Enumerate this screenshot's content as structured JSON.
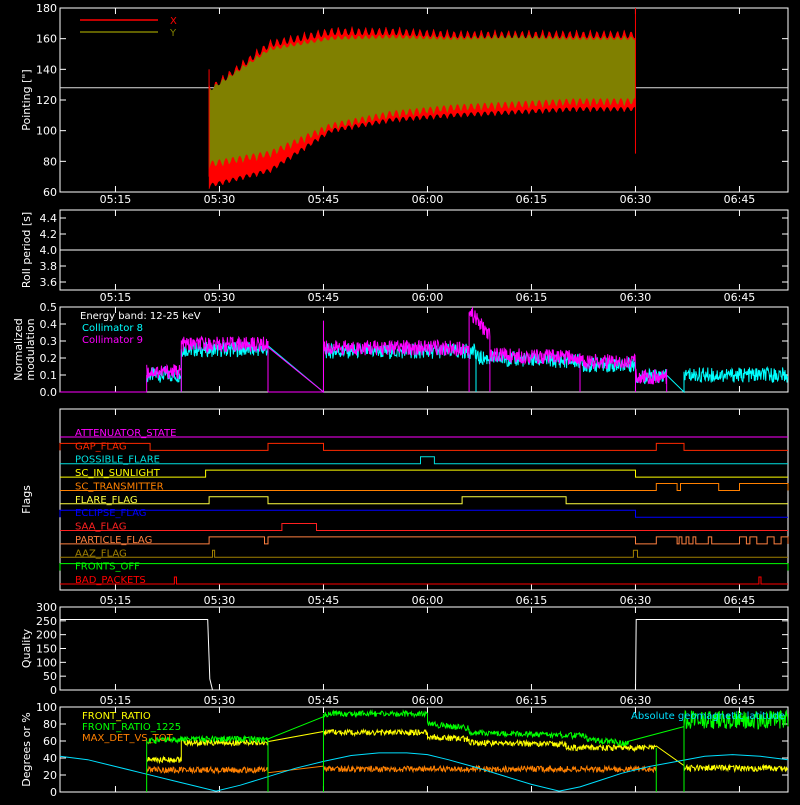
{
  "chart_data": {
    "type": "line",
    "time_ticks": [
      "05:15",
      "05:30",
      "05:45",
      "06:00",
      "06:15",
      "06:30",
      "06:45"
    ],
    "time_tick_minutes": [
      315,
      330,
      345,
      360,
      375,
      390,
      405
    ],
    "time_range_minutes": [
      307,
      412
    ],
    "panels": [
      {
        "id": "pointing",
        "ylabel": "Pointing [\"]",
        "yticks": [
          "60",
          "80",
          "100",
          "120",
          "140",
          "160",
          "180"
        ],
        "ylim": [
          60,
          180
        ],
        "reference_line": 128,
        "series": [
          {
            "name": "X",
            "color": "#ff0000",
            "active_minutes": [
              328.5,
              390
            ],
            "env_min": [
              62,
              72,
              98,
              105,
              108,
              110,
              112,
              112
            ],
            "env_max": [
              130,
              160,
              168,
              168,
              166,
              166,
              166,
              166
            ]
          },
          {
            "name": "Y",
            "color": "#808000",
            "active_minutes": [
              328.5,
              390
            ],
            "env_min": [
              75,
              82,
              100,
              108,
              112,
              114,
              116,
              116
            ],
            "env_max": [
              128,
              155,
              162,
              163,
              162,
              163,
              162,
              162
            ]
          }
        ]
      },
      {
        "id": "roll",
        "ylabel": "Roll period [s]",
        "yticks": [
          "3.6",
          "3.8",
          "4.0",
          "4.2",
          "4.4"
        ],
        "ylim": [
          3.5,
          4.5
        ],
        "value": 4.0
      },
      {
        "id": "modulation",
        "ylabel": [
          "Normalized",
          "modulation"
        ],
        "yticks": [
          "0.0",
          "0.1",
          "0.2",
          "0.3",
          "0.4",
          "0.5"
        ],
        "ylim": [
          0,
          0.5
        ],
        "annotation": "Energy band: 12-25 keV",
        "series": [
          {
            "name": "Collimator 8",
            "color": "#00ffff",
            "segments": [
              {
                "x": [
                  319.5,
                  324.5
                ],
                "y": [
                  0.1,
                  0.1
                ]
              },
              {
                "x": [
                  324.5,
                  337
                ],
                "y": [
                  0.25,
                  0.25
                ]
              },
              {
                "x": [
                  345,
                  367
                ],
                "y": [
                  0.24,
                  0.24
                ]
              },
              {
                "x": [
                  367,
                  382
                ],
                "y": [
                  0.2,
                  0.18
                ]
              },
              {
                "x": [
                  382,
                  390
                ],
                "y": [
                  0.16,
                  0.16
                ]
              },
              {
                "x": [
                  390,
                  394.5
                ],
                "y": [
                  0.09,
                  0.09
                ]
              },
              {
                "x": [
                  397,
                  412
                ],
                "y": [
                  0.1,
                  0.1
                ]
              }
            ]
          },
          {
            "name": "Collimator 9",
            "color": "#ff00ff",
            "segments": [
              {
                "x": [
                  319.5,
                  324.5
                ],
                "y": [
                  0.12,
                  0.12
                ]
              },
              {
                "x": [
                  324.5,
                  337
                ],
                "y": [
                  0.28,
                  0.28
                ]
              },
              {
                "x": [
                  345,
                  366
                ],
                "y": [
                  0.26,
                  0.26
                ]
              },
              {
                "x": [
                  366,
                  369
                ],
                "y": [
                  0.48,
                  0.33
                ]
              },
              {
                "x": [
                  369,
                  382
                ],
                "y": [
                  0.22,
                  0.2
                ]
              },
              {
                "x": [
                  382,
                  390
                ],
                "y": [
                  0.18,
                  0.18
                ]
              },
              {
                "x": [
                  390,
                  394.5
                ],
                "y": [
                  0.09,
                  0.09
                ]
              }
            ]
          }
        ]
      },
      {
        "id": "flags",
        "ylabel": "Flags",
        "flags": [
          {
            "name": "ATTENUATOR_STATE",
            "color": "#ff00ff",
            "high": []
          },
          {
            "name": "GAP_FLAG",
            "color": "#ff2a00",
            "high": [
              [
                307,
                320
              ],
              [
                337,
                345
              ],
              [
                393,
                397
              ]
            ]
          },
          {
            "name": "POSSIBLE_FLARE",
            "color": "#00e0e0",
            "high": [
              [
                359,
                361
              ]
            ]
          },
          {
            "name": "SC_IN_SUNLIGHT",
            "color": "#ffff00",
            "high": [
              [
                328,
                390
              ]
            ]
          },
          {
            "name": "SC_TRANSMITTER",
            "color": "#ff8000",
            "high": [
              [
                393,
                396
              ],
              [
                396.5,
                402
              ],
              [
                405,
                412
              ]
            ]
          },
          {
            "name": "FLARE_FLAG",
            "color": "#ffff40",
            "high": [
              [
                328.5,
                337
              ],
              [
                365,
                380
              ]
            ]
          },
          {
            "name": "ECLIPSE_FLAG",
            "color": "#0000ff",
            "high": [
              [
                307,
                390
              ]
            ]
          },
          {
            "name": "SAA_FLAG",
            "color": "#ff2020",
            "high": [
              [
                339,
                344
              ]
            ]
          },
          {
            "name": "PARTICLE_FLAG",
            "color": "#ff8040",
            "high": [
              [
                328.5,
                336.5
              ],
              [
                337,
                390
              ],
              [
                393,
                396
              ],
              [
                396.3,
                396.7
              ],
              [
                397.3,
                397.7
              ],
              [
                398.3,
                398.7
              ],
              [
                400.5,
                401
              ],
              [
                405,
                406
              ],
              [
                406.5,
                407.5
              ],
              [
                409,
                410
              ],
              [
                411,
                412
              ]
            ]
          },
          {
            "name": "AAZ_FLAG",
            "color": "#a08000",
            "high": [
              [
                329,
                329.3
              ],
              [
                389.7,
                390.3
              ]
            ]
          },
          {
            "name": "FRONTS_OFF",
            "color": "#00ff00",
            "high": [
              [
                307,
                412
              ]
            ]
          },
          {
            "name": "BAD_PACKETS",
            "color": "#ff0000",
            "high": [
              [
                323.5,
                323.8
              ],
              [
                407.8,
                408.1
              ]
            ]
          }
        ]
      },
      {
        "id": "quality",
        "ylabel": "Quality",
        "yticks": [
          "0",
          "50",
          "100",
          "150",
          "200",
          "250",
          "300"
        ],
        "ylim": [
          0,
          300
        ],
        "series": [
          {
            "name": "",
            "color": "#ffffff",
            "x": [
              307,
              328.3,
              328.6,
              329.0,
              390.0,
              390.1,
              412
            ],
            "y": [
              255,
              255,
              40,
              0,
              0,
              255,
              255
            ]
          }
        ]
      },
      {
        "id": "geomagnetic",
        "ylabel": "Degrees or %",
        "yticks": [
          "0",
          "20",
          "40",
          "60",
          "80",
          "100"
        ],
        "ylim": [
          0,
          100
        ],
        "annotation": "Absolute geomagnetic latitude",
        "series": [
          {
            "name": "FRONT_RATIO",
            "color": "#ffff00",
            "segments": [
              {
                "x": [
                  319.5,
                  324.5
                ],
                "y": [
                  38,
                  38
                ]
              },
              {
                "x": [
                  324.5,
                  337
                ],
                "y": [
                  58,
                  58
                ]
              },
              {
                "x": [
                  345,
                  360
                ],
                "y": [
                  70,
                  70
                ]
              },
              {
                "x": [
                  360,
                  366
                ],
                "y": [
                  65,
                  62
                ]
              },
              {
                "x": [
                  366,
                  380
                ],
                "y": [
                  58,
                  56
                ]
              },
              {
                "x": [
                  380,
                  393
                ],
                "y": [
                  52,
                  52
                ]
              },
              {
                "x": [
                  397,
                  412
                ],
                "y": [
                  28,
                  28
                ]
              }
            ]
          },
          {
            "name": "FRONT_RATIO_1225",
            "color": "#00ff00",
            "segments": [
              {
                "x": [
                  319.5,
                  324.5
                ],
                "y": [
                  60,
                  62
                ]
              },
              {
                "x": [
                  324.5,
                  337
                ],
                "y": [
                  62,
                  62
                ]
              },
              {
                "x": [
                  345,
                  360
                ],
                "y": [
                  92,
                  92
                ]
              },
              {
                "x": [
                  360,
                  366
                ],
                "y": [
                  80,
                  75
                ]
              },
              {
                "x": [
                  366,
                  383
                ],
                "y": [
                  70,
                  66
                ]
              },
              {
                "x": [
                  383,
                  389
                ],
                "y": [
                  62,
                  57
                ]
              },
              {
                "x": [
                  397,
                  412
                ],
                "y": [
                  85,
                  85
                ]
              }
            ]
          },
          {
            "name": "MAX_DET_VS_TOT",
            "color": "#ff8000",
            "segments": [
              {
                "x": [
                  319.5,
                  337
                ],
                "y": [
                  26,
                  26
                ]
              },
              {
                "x": [
                  345,
                  393
                ],
                "y": [
                  27,
                  27
                ]
              }
            ]
          },
          {
            "name": "",
            "color": "#00e0ff",
            "x": [
              307,
              311,
              315,
              319,
              323,
              327,
              329.5,
              333,
              337,
              341,
              345,
              349,
              353,
              357,
              360,
              363,
              367,
              371,
              375,
              379,
              382,
              385,
              388,
              392,
              396,
              400,
              404,
              408,
              412
            ],
            "y": [
              42,
              38,
              30,
              22,
              14,
              6,
              1,
              8,
              18,
              28,
              36,
              43,
              46,
              46,
              44,
              38,
              29,
              19,
              9,
              1,
              6,
              14,
              22,
              30,
              36,
              42,
              44,
              42,
              38
            ]
          }
        ]
      }
    ]
  }
}
